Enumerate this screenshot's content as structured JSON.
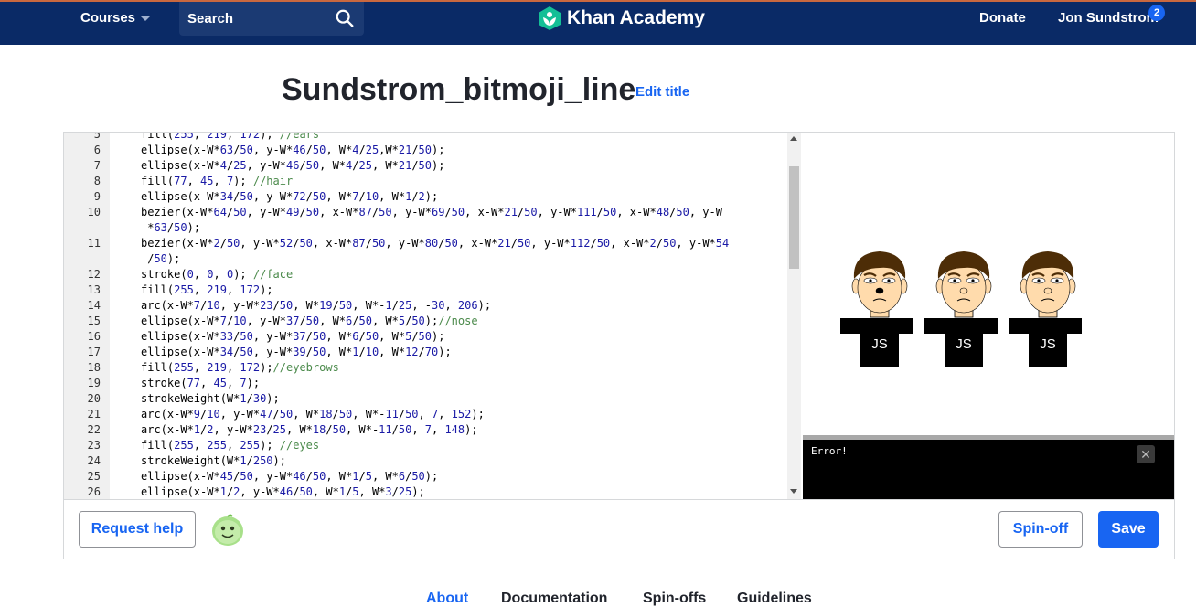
{
  "nav": {
    "courses": "Courses",
    "search_label": "Search",
    "brand": "Khan Academy",
    "donate": "Donate",
    "user": "Jon Sundstrom",
    "notification_count": "2"
  },
  "program": {
    "title": "Sundstrom_bitmoji_line",
    "edit_title": "Edit title"
  },
  "code_lines": [
    {
      "n": "5",
      "segments": [
        [
          "t",
          "fill("
        ],
        [
          "n",
          "255"
        ],
        [
          "t",
          ", "
        ],
        [
          "n",
          "219"
        ],
        [
          "t",
          ", "
        ],
        [
          "n",
          "172"
        ],
        [
          "t",
          "); "
        ],
        [
          "c",
          "//ears"
        ]
      ]
    },
    {
      "n": "6",
      "segments": [
        [
          "t",
          "ellipse(x-W*"
        ],
        [
          "n",
          "63"
        ],
        [
          "t",
          "/"
        ],
        [
          "n",
          "50"
        ],
        [
          "t",
          ", y-W*"
        ],
        [
          "n",
          "46"
        ],
        [
          "t",
          "/"
        ],
        [
          "n",
          "50"
        ],
        [
          "t",
          ", W*"
        ],
        [
          "n",
          "4"
        ],
        [
          "t",
          "/"
        ],
        [
          "n",
          "25"
        ],
        [
          "t",
          ",W*"
        ],
        [
          "n",
          "21"
        ],
        [
          "t",
          "/"
        ],
        [
          "n",
          "50"
        ],
        [
          "t",
          ");"
        ]
      ]
    },
    {
      "n": "7",
      "segments": [
        [
          "t",
          "ellipse(x-W*"
        ],
        [
          "n",
          "4"
        ],
        [
          "t",
          "/"
        ],
        [
          "n",
          "25"
        ],
        [
          "t",
          ", y-W*"
        ],
        [
          "n",
          "46"
        ],
        [
          "t",
          "/"
        ],
        [
          "n",
          "50"
        ],
        [
          "t",
          ", W*"
        ],
        [
          "n",
          "4"
        ],
        [
          "t",
          "/"
        ],
        [
          "n",
          "25"
        ],
        [
          "t",
          ", W*"
        ],
        [
          "n",
          "21"
        ],
        [
          "t",
          "/"
        ],
        [
          "n",
          "50"
        ],
        [
          "t",
          ");"
        ]
      ]
    },
    {
      "n": "8",
      "segments": [
        [
          "t",
          "fill("
        ],
        [
          "n",
          "77"
        ],
        [
          "t",
          ", "
        ],
        [
          "n",
          "45"
        ],
        [
          "t",
          ", "
        ],
        [
          "n",
          "7"
        ],
        [
          "t",
          "); "
        ],
        [
          "c",
          "//hair"
        ]
      ]
    },
    {
      "n": "9",
      "segments": [
        [
          "t",
          "ellipse(x-W*"
        ],
        [
          "n",
          "34"
        ],
        [
          "t",
          "/"
        ],
        [
          "n",
          "50"
        ],
        [
          "t",
          ", y-W*"
        ],
        [
          "n",
          "72"
        ],
        [
          "t",
          "/"
        ],
        [
          "n",
          "50"
        ],
        [
          "t",
          ", W*"
        ],
        [
          "n",
          "7"
        ],
        [
          "t",
          "/"
        ],
        [
          "n",
          "10"
        ],
        [
          "t",
          ", W*"
        ],
        [
          "n",
          "1"
        ],
        [
          "t",
          "/"
        ],
        [
          "n",
          "2"
        ],
        [
          "t",
          ");"
        ]
      ]
    },
    {
      "n": "10",
      "segments": [
        [
          "t",
          "bezier(x-W*"
        ],
        [
          "n",
          "64"
        ],
        [
          "t",
          "/"
        ],
        [
          "n",
          "50"
        ],
        [
          "t",
          ", y-W*"
        ],
        [
          "n",
          "49"
        ],
        [
          "t",
          "/"
        ],
        [
          "n",
          "50"
        ],
        [
          "t",
          ", x-W*"
        ],
        [
          "n",
          "87"
        ],
        [
          "t",
          "/"
        ],
        [
          "n",
          "50"
        ],
        [
          "t",
          ", y-W*"
        ],
        [
          "n",
          "69"
        ],
        [
          "t",
          "/"
        ],
        [
          "n",
          "50"
        ],
        [
          "t",
          ", x-W*"
        ],
        [
          "n",
          "21"
        ],
        [
          "t",
          "/"
        ],
        [
          "n",
          "50"
        ],
        [
          "t",
          ", y-W*"
        ],
        [
          "n",
          "111"
        ],
        [
          "t",
          "/"
        ],
        [
          "n",
          "50"
        ],
        [
          "t",
          ", x-W*"
        ],
        [
          "n",
          "48"
        ],
        [
          "t",
          "/"
        ],
        [
          "n",
          "50"
        ],
        [
          "t",
          ", y-W"
        ]
      ]
    },
    {
      "n": "",
      "segments": [
        [
          "t",
          " *"
        ],
        [
          "n",
          "63"
        ],
        [
          "t",
          "/"
        ],
        [
          "n",
          "50"
        ],
        [
          "t",
          ");"
        ]
      ]
    },
    {
      "n": "11",
      "segments": [
        [
          "t",
          "bezier(x-W*"
        ],
        [
          "n",
          "2"
        ],
        [
          "t",
          "/"
        ],
        [
          "n",
          "50"
        ],
        [
          "t",
          ", y-W*"
        ],
        [
          "n",
          "52"
        ],
        [
          "t",
          "/"
        ],
        [
          "n",
          "50"
        ],
        [
          "t",
          ", x-W*"
        ],
        [
          "n",
          "87"
        ],
        [
          "t",
          "/"
        ],
        [
          "n",
          "50"
        ],
        [
          "t",
          ", y-W*"
        ],
        [
          "n",
          "80"
        ],
        [
          "t",
          "/"
        ],
        [
          "n",
          "50"
        ],
        [
          "t",
          ", x-W*"
        ],
        [
          "n",
          "21"
        ],
        [
          "t",
          "/"
        ],
        [
          "n",
          "50"
        ],
        [
          "t",
          ", y-W*"
        ],
        [
          "n",
          "112"
        ],
        [
          "t",
          "/"
        ],
        [
          "n",
          "50"
        ],
        [
          "t",
          ", x-W*"
        ],
        [
          "n",
          "2"
        ],
        [
          "t",
          "/"
        ],
        [
          "n",
          "50"
        ],
        [
          "t",
          ", y-W*"
        ],
        [
          "n",
          "54"
        ]
      ]
    },
    {
      "n": "",
      "segments": [
        [
          "t",
          " /"
        ],
        [
          "n",
          "50"
        ],
        [
          "t",
          ");"
        ]
      ]
    },
    {
      "n": "12",
      "segments": [
        [
          "t",
          "stroke("
        ],
        [
          "n",
          "0"
        ],
        [
          "t",
          ", "
        ],
        [
          "n",
          "0"
        ],
        [
          "t",
          ", "
        ],
        [
          "n",
          "0"
        ],
        [
          "t",
          "); "
        ],
        [
          "c",
          "//face"
        ]
      ]
    },
    {
      "n": "13",
      "segments": [
        [
          "t",
          "fill("
        ],
        [
          "n",
          "255"
        ],
        [
          "t",
          ", "
        ],
        [
          "n",
          "219"
        ],
        [
          "t",
          ", "
        ],
        [
          "n",
          "172"
        ],
        [
          "t",
          ");"
        ]
      ]
    },
    {
      "n": "14",
      "segments": [
        [
          "t",
          "arc(x-W*"
        ],
        [
          "n",
          "7"
        ],
        [
          "t",
          "/"
        ],
        [
          "n",
          "10"
        ],
        [
          "t",
          ", y-W*"
        ],
        [
          "n",
          "23"
        ],
        [
          "t",
          "/"
        ],
        [
          "n",
          "50"
        ],
        [
          "t",
          ", W*"
        ],
        [
          "n",
          "19"
        ],
        [
          "t",
          "/"
        ],
        [
          "n",
          "50"
        ],
        [
          "t",
          ", W*-"
        ],
        [
          "n",
          "1"
        ],
        [
          "t",
          "/"
        ],
        [
          "n",
          "25"
        ],
        [
          "t",
          ", -"
        ],
        [
          "n",
          "30"
        ],
        [
          "t",
          ", "
        ],
        [
          "n",
          "206"
        ],
        [
          "t",
          ");"
        ]
      ]
    },
    {
      "n": "15",
      "segments": [
        [
          "t",
          "ellipse(x-W*"
        ],
        [
          "n",
          "7"
        ],
        [
          "t",
          "/"
        ],
        [
          "n",
          "10"
        ],
        [
          "t",
          ", y-W*"
        ],
        [
          "n",
          "37"
        ],
        [
          "t",
          "/"
        ],
        [
          "n",
          "50"
        ],
        [
          "t",
          ", W*"
        ],
        [
          "n",
          "6"
        ],
        [
          "t",
          "/"
        ],
        [
          "n",
          "50"
        ],
        [
          "t",
          ", W*"
        ],
        [
          "n",
          "5"
        ],
        [
          "t",
          "/"
        ],
        [
          "n",
          "50"
        ],
        [
          "t",
          ");"
        ],
        [
          "c",
          "//nose"
        ]
      ]
    },
    {
      "n": "16",
      "segments": [
        [
          "t",
          "ellipse(x-W*"
        ],
        [
          "n",
          "33"
        ],
        [
          "t",
          "/"
        ],
        [
          "n",
          "50"
        ],
        [
          "t",
          ", y-W*"
        ],
        [
          "n",
          "37"
        ],
        [
          "t",
          "/"
        ],
        [
          "n",
          "50"
        ],
        [
          "t",
          ", W*"
        ],
        [
          "n",
          "6"
        ],
        [
          "t",
          "/"
        ],
        [
          "n",
          "50"
        ],
        [
          "t",
          ", W*"
        ],
        [
          "n",
          "5"
        ],
        [
          "t",
          "/"
        ],
        [
          "n",
          "50"
        ],
        [
          "t",
          ");"
        ]
      ]
    },
    {
      "n": "17",
      "segments": [
        [
          "t",
          "ellipse(x-W*"
        ],
        [
          "n",
          "34"
        ],
        [
          "t",
          "/"
        ],
        [
          "n",
          "50"
        ],
        [
          "t",
          ", y-W*"
        ],
        [
          "n",
          "39"
        ],
        [
          "t",
          "/"
        ],
        [
          "n",
          "50"
        ],
        [
          "t",
          ", W*"
        ],
        [
          "n",
          "1"
        ],
        [
          "t",
          "/"
        ],
        [
          "n",
          "10"
        ],
        [
          "t",
          ", W*"
        ],
        [
          "n",
          "12"
        ],
        [
          "t",
          "/"
        ],
        [
          "n",
          "70"
        ],
        [
          "t",
          ");"
        ]
      ]
    },
    {
      "n": "18",
      "segments": [
        [
          "t",
          "fill("
        ],
        [
          "n",
          "255"
        ],
        [
          "t",
          ", "
        ],
        [
          "n",
          "219"
        ],
        [
          "t",
          ", "
        ],
        [
          "n",
          "172"
        ],
        [
          "t",
          ");"
        ],
        [
          "c",
          "//eyebrows"
        ]
      ]
    },
    {
      "n": "19",
      "segments": [
        [
          "t",
          "stroke("
        ],
        [
          "n",
          "77"
        ],
        [
          "t",
          ", "
        ],
        [
          "n",
          "45"
        ],
        [
          "t",
          ", "
        ],
        [
          "n",
          "7"
        ],
        [
          "t",
          ");"
        ]
      ]
    },
    {
      "n": "20",
      "segments": [
        [
          "t",
          "strokeWeight(W*"
        ],
        [
          "n",
          "1"
        ],
        [
          "t",
          "/"
        ],
        [
          "n",
          "30"
        ],
        [
          "t",
          ");"
        ]
      ]
    },
    {
      "n": "21",
      "segments": [
        [
          "t",
          "arc(x-W*"
        ],
        [
          "n",
          "9"
        ],
        [
          "t",
          "/"
        ],
        [
          "n",
          "10"
        ],
        [
          "t",
          ", y-W*"
        ],
        [
          "n",
          "47"
        ],
        [
          "t",
          "/"
        ],
        [
          "n",
          "50"
        ],
        [
          "t",
          ", W*"
        ],
        [
          "n",
          "18"
        ],
        [
          "t",
          "/"
        ],
        [
          "n",
          "50"
        ],
        [
          "t",
          ", W*-"
        ],
        [
          "n",
          "11"
        ],
        [
          "t",
          "/"
        ],
        [
          "n",
          "50"
        ],
        [
          "t",
          ", "
        ],
        [
          "n",
          "7"
        ],
        [
          "t",
          ", "
        ],
        [
          "n",
          "152"
        ],
        [
          "t",
          ");"
        ]
      ]
    },
    {
      "n": "22",
      "segments": [
        [
          "t",
          "arc(x-W*"
        ],
        [
          "n",
          "1"
        ],
        [
          "t",
          "/"
        ],
        [
          "n",
          "2"
        ],
        [
          "t",
          ", y-W*"
        ],
        [
          "n",
          "23"
        ],
        [
          "t",
          "/"
        ],
        [
          "n",
          "25"
        ],
        [
          "t",
          ", W*"
        ],
        [
          "n",
          "18"
        ],
        [
          "t",
          "/"
        ],
        [
          "n",
          "50"
        ],
        [
          "t",
          ", W*-"
        ],
        [
          "n",
          "11"
        ],
        [
          "t",
          "/"
        ],
        [
          "n",
          "50"
        ],
        [
          "t",
          ", "
        ],
        [
          "n",
          "7"
        ],
        [
          "t",
          ", "
        ],
        [
          "n",
          "148"
        ],
        [
          "t",
          ");"
        ]
      ]
    },
    {
      "n": "23",
      "segments": [
        [
          "t",
          "fill("
        ],
        [
          "n",
          "255"
        ],
        [
          "t",
          ", "
        ],
        [
          "n",
          "255"
        ],
        [
          "t",
          ", "
        ],
        [
          "n",
          "255"
        ],
        [
          "t",
          "); "
        ],
        [
          "c",
          "//eyes"
        ]
      ]
    },
    {
      "n": "24",
      "segments": [
        [
          "t",
          "strokeWeight(W*"
        ],
        [
          "n",
          "1"
        ],
        [
          "t",
          "/"
        ],
        [
          "n",
          "250"
        ],
        [
          "t",
          ");"
        ]
      ]
    },
    {
      "n": "25",
      "segments": [
        [
          "t",
          "ellipse(x-W*"
        ],
        [
          "n",
          "45"
        ],
        [
          "t",
          "/"
        ],
        [
          "n",
          "50"
        ],
        [
          "t",
          ", y-W*"
        ],
        [
          "n",
          "46"
        ],
        [
          "t",
          "/"
        ],
        [
          "n",
          "50"
        ],
        [
          "t",
          ", W*"
        ],
        [
          "n",
          "1"
        ],
        [
          "t",
          "/"
        ],
        [
          "n",
          "5"
        ],
        [
          "t",
          ", W*"
        ],
        [
          "n",
          "6"
        ],
        [
          "t",
          "/"
        ],
        [
          "n",
          "50"
        ],
        [
          "t",
          ");"
        ]
      ]
    },
    {
      "n": "26",
      "segments": [
        [
          "t",
          "ellipse(x-W*"
        ],
        [
          "n",
          "1"
        ],
        [
          "t",
          "/"
        ],
        [
          "n",
          "2"
        ],
        [
          "t",
          ", y-W*"
        ],
        [
          "n",
          "46"
        ],
        [
          "t",
          "/"
        ],
        [
          "n",
          "50"
        ],
        [
          "t",
          ", W*"
        ],
        [
          "n",
          "1"
        ],
        [
          "t",
          "/"
        ],
        [
          "n",
          "5"
        ],
        [
          "t",
          ", W*"
        ],
        [
          "n",
          "3"
        ],
        [
          "t",
          "/"
        ],
        [
          "n",
          "25"
        ],
        [
          "t",
          ");"
        ]
      ]
    }
  ],
  "canvas": {
    "figures": [
      {
        "initials": "JS"
      },
      {
        "initials": "JS"
      },
      {
        "initials": "JS"
      }
    ],
    "colors": {
      "skin": "#ffdbac",
      "hair": "#4d2d07",
      "shirt": "#000000"
    }
  },
  "console": {
    "text": "Error!"
  },
  "toolbar": {
    "request_help": "Request help",
    "spin_off": "Spin-off",
    "save": "Save"
  },
  "tabs": [
    "About",
    "Documentation",
    "Spin-offs",
    "Guidelines"
  ],
  "colors": {
    "nav_bg": "#0a2a66",
    "accent": "#1865f2"
  }
}
